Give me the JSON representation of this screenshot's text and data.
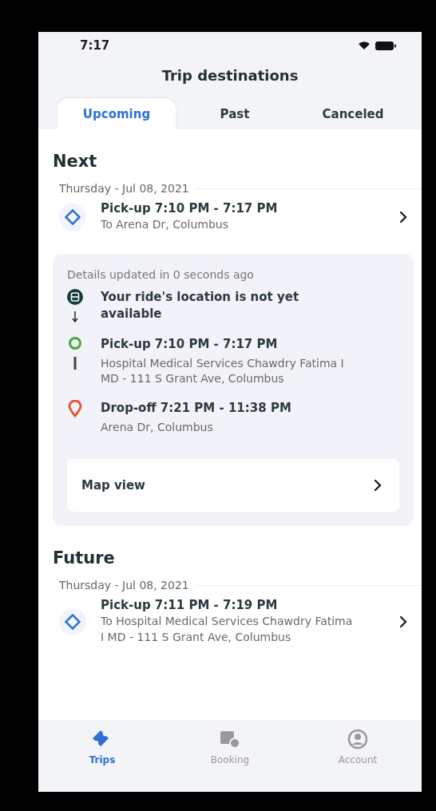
{
  "status_bar": {
    "time": "7:17"
  },
  "header": {
    "title": "Trip destinations"
  },
  "tabs": [
    {
      "label": "Upcoming",
      "selected": true
    },
    {
      "label": "Past",
      "selected": false
    },
    {
      "label": "Canceled",
      "selected": false
    }
  ],
  "next": {
    "heading": "Next",
    "date": "Thursday - Jul 08, 2021",
    "trip": {
      "title": "Pick-up 7:10 PM - 7:17 PM",
      "lines": [
        "To Arena Dr, Columbus"
      ]
    },
    "details": {
      "updated": "Details updated in 0 seconds ago",
      "timeline": [
        {
          "kind": "ride",
          "title": "Your ride's location is not yet available"
        },
        {
          "kind": "pickup",
          "title": "Pick-up 7:10 PM - 7:17 PM",
          "lines": [
            "Hospital Medical Services Chawdry Fatima I MD - 111 S Grant Ave, Columbus"
          ]
        },
        {
          "kind": "dropoff",
          "title": "Drop-off 7:21 PM - 11:38 PM",
          "lines": [
            "Arena Dr, Columbus"
          ]
        }
      ],
      "map_link": "Map view"
    }
  },
  "future": {
    "heading": "Future",
    "date": "Thursday - Jul 08, 2021",
    "trip": {
      "title": "Pick-up 7:11 PM - 7:19 PM",
      "lines": [
        "To Hospital Medical Services Chawdry Fatima I MD - 111 S Grant Ave, Columbus"
      ]
    }
  },
  "bottom_nav": [
    {
      "kind": "trips",
      "label": "Trips",
      "selected": true
    },
    {
      "kind": "booking",
      "label": "Booking",
      "selected": false
    },
    {
      "kind": "account",
      "label": "Account",
      "selected": false
    }
  ]
}
